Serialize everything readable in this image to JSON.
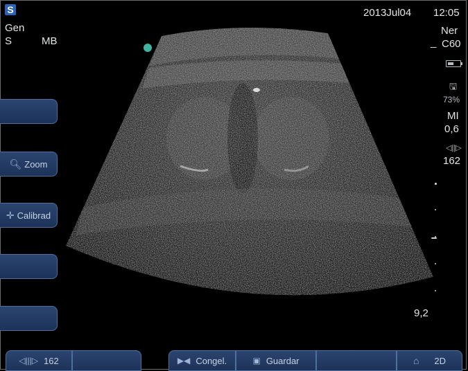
{
  "status": {
    "date": "2013Jul04",
    "time": "12:05"
  },
  "left_info": {
    "mode": "Gen",
    "res": "S",
    "mb": "MB"
  },
  "right_info": {
    "exam": "Ner",
    "probe_prefix": "_",
    "probe": "C60",
    "storage_pct": "73%",
    "mi_label": "MI",
    "mi_value": "0,6",
    "gain_value": "162",
    "depth": "9,2"
  },
  "side_buttons": [
    {
      "label": ""
    },
    {
      "label": "Zoom",
      "icon": "magnifier-icon"
    },
    {
      "label": "Calibrad",
      "icon": "crosshair-icon"
    },
    {
      "label": ""
    },
    {
      "label": ""
    }
  ],
  "bottom_bar": {
    "gain_value": "162",
    "freeze_label": "Congel.",
    "save_label": "Guardar",
    "mode_label": "2D"
  },
  "icons": {
    "logo": "logo-icon",
    "battery": "battery-icon",
    "storage": "disk-icon",
    "gain": "gain-icon",
    "freeze": "freeze-icon",
    "save": "save-icon",
    "probe": "probe-icon"
  },
  "colors": {
    "background": "#000000",
    "button": "#1d3258",
    "button_border": "#4f6f9c",
    "orientation_marker": "#41b3a3"
  }
}
